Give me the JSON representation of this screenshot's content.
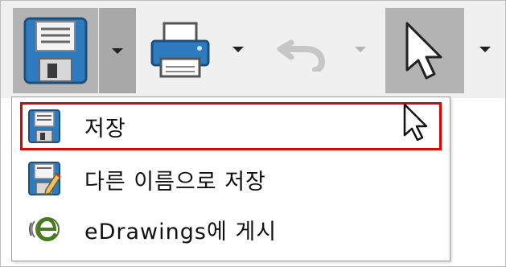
{
  "toolbar": {
    "buttons": [
      {
        "name": "save",
        "icon": "floppy-disk-icon",
        "state": "pressed"
      },
      {
        "name": "print",
        "icon": "printer-icon"
      },
      {
        "name": "undo",
        "icon": "undo-icon",
        "state": "disabled"
      },
      {
        "name": "select",
        "icon": "select-pointer-icon",
        "state": "pressed"
      }
    ]
  },
  "menu": {
    "items": [
      {
        "label": "저장",
        "icon": "floppy-disk-icon",
        "highlighted": true
      },
      {
        "label": "다른 이름으로 저장",
        "icon": "save-as-icon"
      },
      {
        "label": "eDrawings에 게시",
        "icon": "edrawings-icon"
      }
    ]
  },
  "colors": {
    "highlight_border": "#e00000",
    "floppy_body": "#2e7bbf",
    "toolbar_bg": "#f0f0f0"
  }
}
